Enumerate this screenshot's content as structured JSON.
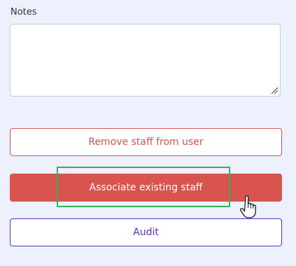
{
  "notes": {
    "label": "Notes",
    "value": "",
    "placeholder": ""
  },
  "buttons": {
    "remove_staff": "Remove staff from user",
    "associate_staff": "Associate existing staff",
    "audit": "Audit"
  },
  "icons": {
    "resize_handle": "resize-handle-icon",
    "cursor": "hand-pointer-cursor-icon"
  },
  "colors": {
    "background": "#edf1fd",
    "danger": "#d9534f",
    "accent": "#5b2fc9",
    "focus_highlight": "#35b15d"
  }
}
